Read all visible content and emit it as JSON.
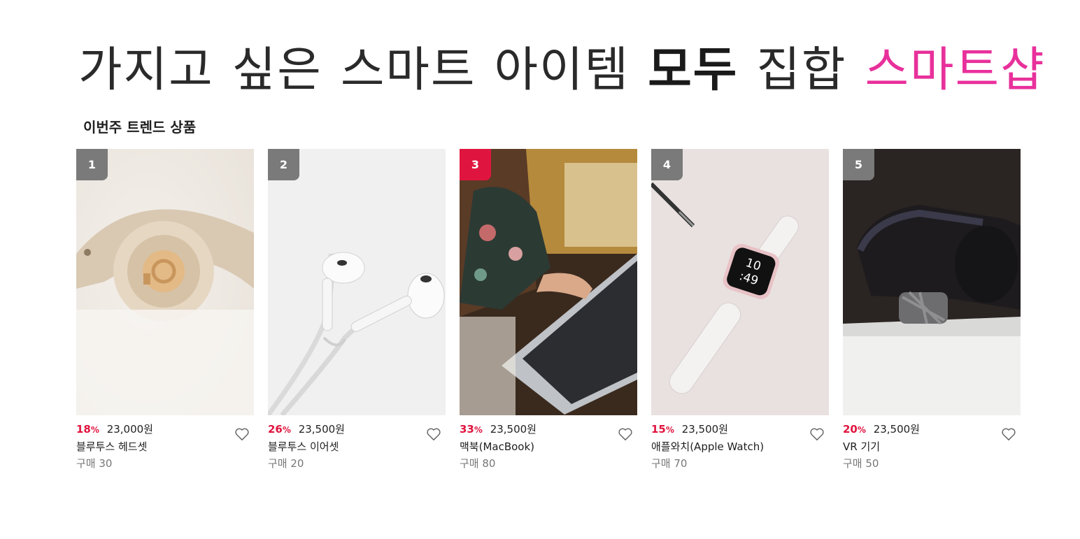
{
  "hero": {
    "parts": [
      "가지고",
      "싶은",
      "스마트",
      "아이템",
      "모두",
      "집합",
      "스마트샵"
    ],
    "brand_color": "#e8309b"
  },
  "section": {
    "title": "이번주 트렌드 상품"
  },
  "colors": {
    "accent": "#e0153f",
    "rank_default": "#7a7a7a",
    "rank_highlight": "#e0153f"
  },
  "products": [
    {
      "rank": "1",
      "discount": "18",
      "discount_unit": "%",
      "price": "23,000원",
      "name": "블루투스 헤드셋",
      "sales": "구매 30",
      "image": "headphones"
    },
    {
      "rank": "2",
      "discount": "26",
      "discount_unit": "%",
      "price": "23,500원",
      "name": "블루투스 이어셋",
      "sales": "구매 20",
      "image": "earphones"
    },
    {
      "rank": "3",
      "discount": "33",
      "discount_unit": "%",
      "price": "23,500원",
      "name": "맥북(MacBook)",
      "sales": "구매 80",
      "image": "laptop"
    },
    {
      "rank": "4",
      "discount": "15",
      "discount_unit": "%",
      "price": "23,500원",
      "name": "애플와치(Apple Watch)",
      "sales": "구매 70",
      "image": "watch",
      "watch_time": "10\n:49"
    },
    {
      "rank": "5",
      "discount": "20",
      "discount_unit": "%",
      "price": "23,500원",
      "name": "VR 기기",
      "sales": "구매 50",
      "image": "vr-headset"
    }
  ],
  "icons": {
    "like": "heart-outline-icon"
  }
}
